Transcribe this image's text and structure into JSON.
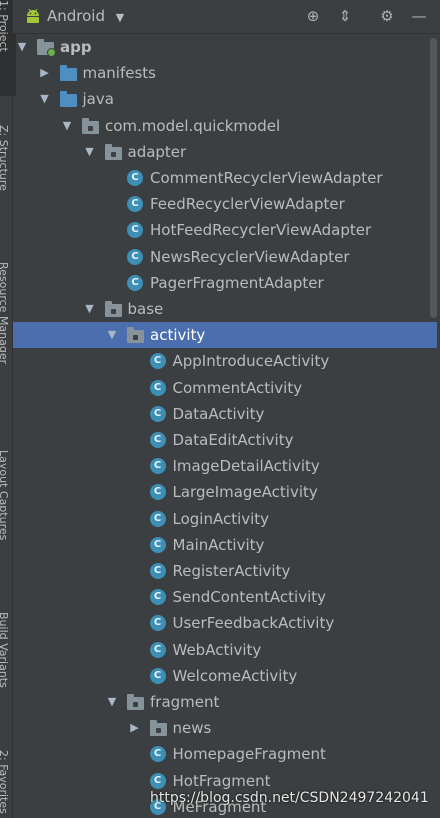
{
  "side_tabs": [
    {
      "label": "1: Project",
      "active": true
    },
    {
      "label": "Z: Structure",
      "active": false
    },
    {
      "label": "Resource Manager",
      "active": false
    },
    {
      "label": "Layout Captures",
      "active": false
    },
    {
      "label": "Build Variants",
      "active": false
    },
    {
      "label": "2: Favorites",
      "active": false
    }
  ],
  "topbar": {
    "view_selector": "Android",
    "icons": [
      "target-icon",
      "collapse-all-icon",
      "gear-icon",
      "minimize-icon"
    ]
  },
  "tree": [
    {
      "label": "app",
      "depth": 0,
      "icon": "module-folder-icon",
      "expanded": true
    },
    {
      "label": "manifests",
      "depth": 1,
      "icon": "folder-icon",
      "expanded": false
    },
    {
      "label": "java",
      "depth": 1,
      "icon": "folder-icon",
      "expanded": true
    },
    {
      "label": "com.model.quickmodel",
      "depth": 2,
      "icon": "package-icon",
      "expanded": true
    },
    {
      "label": "adapter",
      "depth": 3,
      "icon": "package-icon",
      "expanded": true
    },
    {
      "label": "CommentRecyclerViewAdapter",
      "depth": 4,
      "icon": "class-icon"
    },
    {
      "label": "FeedRecyclerViewAdapter",
      "depth": 4,
      "icon": "class-icon"
    },
    {
      "label": "HotFeedRecyclerViewAdapter",
      "depth": 4,
      "icon": "class-icon"
    },
    {
      "label": "NewsRecyclerViewAdapter",
      "depth": 4,
      "icon": "class-icon"
    },
    {
      "label": "PagerFragmentAdapter",
      "depth": 4,
      "icon": "class-icon"
    },
    {
      "label": "base",
      "depth": 3,
      "icon": "package-icon",
      "expanded": true
    },
    {
      "label": "activity",
      "depth": 4,
      "icon": "package-icon",
      "expanded": true,
      "selected": true
    },
    {
      "label": "AppIntroduceActivity",
      "depth": 5,
      "icon": "class-icon"
    },
    {
      "label": "CommentActivity",
      "depth": 5,
      "icon": "class-icon"
    },
    {
      "label": "DataActivity",
      "depth": 5,
      "icon": "class-icon"
    },
    {
      "label": "DataEditActivity",
      "depth": 5,
      "icon": "class-icon"
    },
    {
      "label": "ImageDetailActivity",
      "depth": 5,
      "icon": "class-icon"
    },
    {
      "label": "LargeImageActivity",
      "depth": 5,
      "icon": "class-icon"
    },
    {
      "label": "LoginActivity",
      "depth": 5,
      "icon": "class-icon"
    },
    {
      "label": "MainActivity",
      "depth": 5,
      "icon": "class-icon"
    },
    {
      "label": "RegisterActivity",
      "depth": 5,
      "icon": "class-icon"
    },
    {
      "label": "SendContentActivity",
      "depth": 5,
      "icon": "class-icon"
    },
    {
      "label": "UserFeedbackActivity",
      "depth": 5,
      "icon": "class-icon"
    },
    {
      "label": "WebActivity",
      "depth": 5,
      "icon": "class-icon"
    },
    {
      "label": "WelcomeActivity",
      "depth": 5,
      "icon": "class-icon"
    },
    {
      "label": "fragment",
      "depth": 4,
      "icon": "package-icon",
      "expanded": true
    },
    {
      "label": "news",
      "depth": 5,
      "icon": "package-icon",
      "expanded": false
    },
    {
      "label": "HomepageFragment",
      "depth": 5,
      "icon": "class-icon"
    },
    {
      "label": "HotFragment",
      "depth": 5,
      "icon": "class-icon"
    },
    {
      "label": "MeFragment",
      "depth": 5,
      "icon": "class-icon"
    }
  ],
  "watermark": "https://blog.csdn.net/CSDN2497242041",
  "colors": {
    "background": "#3c3f41",
    "selection": "#4b6eaf",
    "class_icon": "#3d8fb5",
    "folder_blue": "#4e8ec2"
  }
}
